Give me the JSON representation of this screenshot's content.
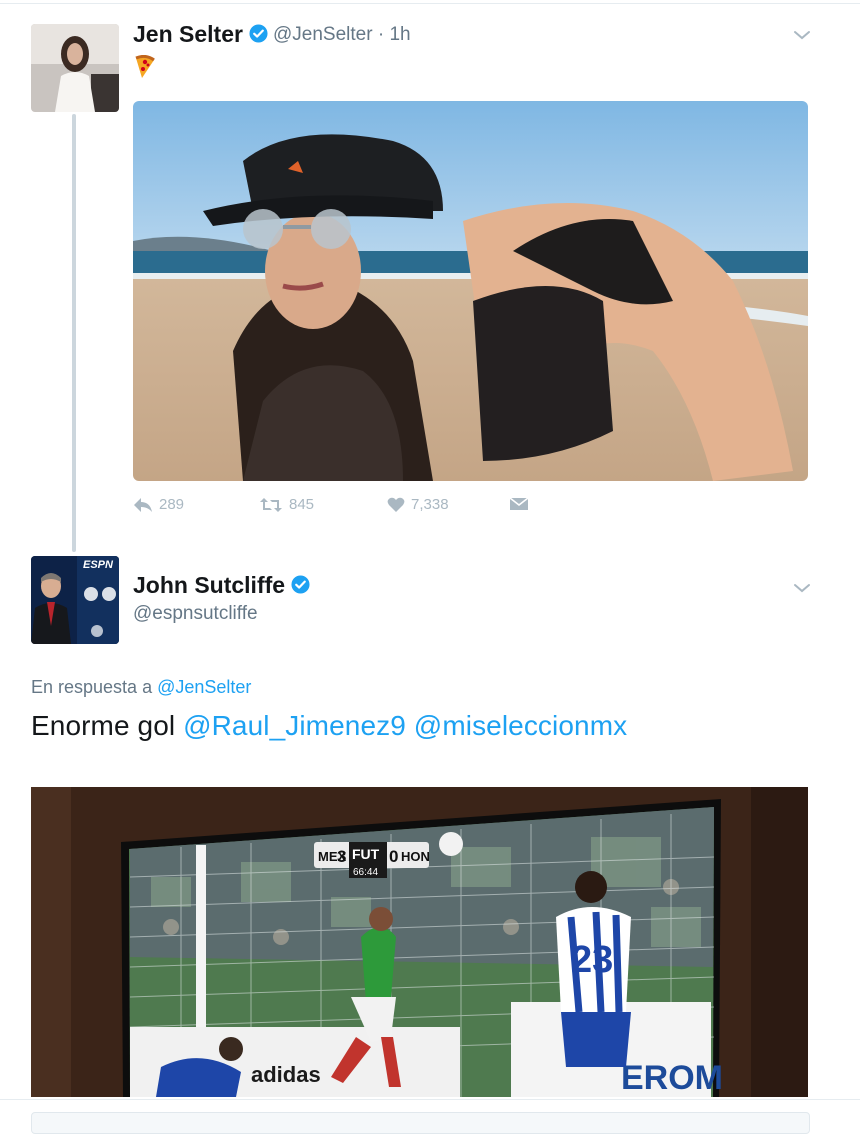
{
  "tweet1": {
    "author_name": "Jen Selter",
    "handle_time": "@JenSelter · 1h",
    "emoji": "pizza-emoji",
    "actions": {
      "reply_count": "289",
      "retweet_count": "845",
      "like_count": "7,338"
    }
  },
  "tweet2": {
    "author_name": "John Sutcliffe",
    "handle": "@espnsutcliffe",
    "avatar_text": "ESPN",
    "reply_prefix": "En respuesta a",
    "reply_mention": "@JenSelter",
    "text_plain": "Enorme gol",
    "text_mention1": "@Raul_Jimenez9",
    "text_mention2": "@miseleccionmx",
    "scoreboard": {
      "home": "MEX",
      "home_score": "3",
      "brand": "FUT",
      "away_score": "0",
      "away": "HON",
      "clock": "66:44",
      "player_number": "23",
      "ad_text": "EROM"
    }
  },
  "colors": {
    "link": "#1da1f2",
    "verified": "#1da1f2",
    "muted": "#657786",
    "action": "#aab8c2"
  }
}
